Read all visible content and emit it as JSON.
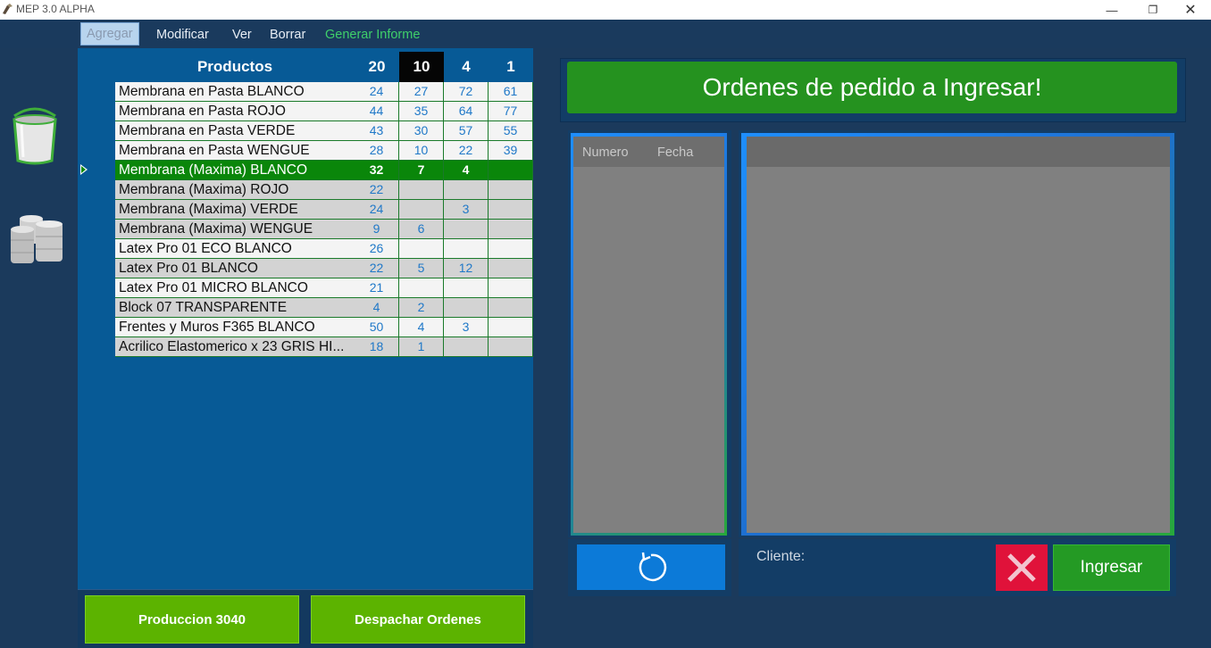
{
  "window": {
    "title": "MEP 3.0 ALPHA"
  },
  "menu": [
    {
      "label": "Agregar"
    },
    {
      "label": "Modificar"
    },
    {
      "label": "Ver"
    },
    {
      "label": "Borrar"
    },
    {
      "label": "Generar Informe"
    }
  ],
  "sidebar": {
    "icons": [
      "bucket-icon",
      "barrels-icon"
    ]
  },
  "products": {
    "header": {
      "name": "Productos",
      "columns": [
        "20",
        "10",
        "4",
        "1"
      ]
    },
    "rows": [
      {
        "name": "Membrana en Pasta BLANCO",
        "values": [
          "24",
          "27",
          "72",
          "61"
        ],
        "style": "white",
        "selected": false
      },
      {
        "name": "Membrana en Pasta ROJO",
        "values": [
          "44",
          "35",
          "64",
          "77"
        ],
        "style": "white",
        "selected": false
      },
      {
        "name": "Membrana en Pasta VERDE",
        "values": [
          "43",
          "30",
          "57",
          "55"
        ],
        "style": "white",
        "selected": false
      },
      {
        "name": "Membrana en Pasta WENGUE",
        "values": [
          "28",
          "10",
          "22",
          "39"
        ],
        "style": "white",
        "selected": false
      },
      {
        "name": "Membrana (Maxima) BLANCO",
        "values": [
          "32",
          "7",
          "4",
          ""
        ],
        "style": "sel",
        "selected": true
      },
      {
        "name": "Membrana (Maxima) ROJO",
        "values": [
          "22",
          "",
          "",
          ""
        ],
        "style": "gray",
        "selected": false
      },
      {
        "name": "Membrana (Maxima) VERDE",
        "values": [
          "24",
          "",
          "3",
          ""
        ],
        "style": "gray",
        "selected": false
      },
      {
        "name": "Membrana (Maxima) WENGUE",
        "values": [
          "9",
          "6",
          "",
          ""
        ],
        "style": "gray",
        "selected": false
      },
      {
        "name": "Latex Pro 01 ECO BLANCO",
        "values": [
          "26",
          "",
          "",
          ""
        ],
        "style": "white",
        "selected": false
      },
      {
        "name": "Latex Pro 01 BLANCO",
        "values": [
          "22",
          "5",
          "12",
          ""
        ],
        "style": "gray",
        "selected": false
      },
      {
        "name": "Latex Pro 01 MICRO BLANCO",
        "values": [
          "21",
          "",
          "",
          ""
        ],
        "style": "white",
        "selected": false
      },
      {
        "name": "Block 07 TRANSPARENTE",
        "values": [
          "4",
          "2",
          "",
          ""
        ],
        "style": "gray",
        "selected": false
      },
      {
        "name": "Frentes y Muros F365 BLANCO",
        "values": [
          "50",
          "4",
          "3",
          ""
        ],
        "style": "white",
        "selected": false
      },
      {
        "name": "Acrilico Elastomerico x 23 GRIS HI...",
        "values": [
          "18",
          "1",
          "",
          ""
        ],
        "style": "gray",
        "selected": false
      }
    ]
  },
  "bottom": {
    "produccion_label": "Produccion  3040",
    "despachar_label": "Despachar Ordenes"
  },
  "orders": {
    "banner": "Ordenes de pedido a Ingresar!",
    "list_columns": [
      "Numero",
      "Fecha"
    ],
    "client_label": "Cliente:",
    "ingresar_label": "Ingresar"
  },
  "colors": {
    "accent_green": "#25921f",
    "selected_row": "#0a860a",
    "panel_blue": "#075a96",
    "cancel_red": "#e0123a"
  }
}
